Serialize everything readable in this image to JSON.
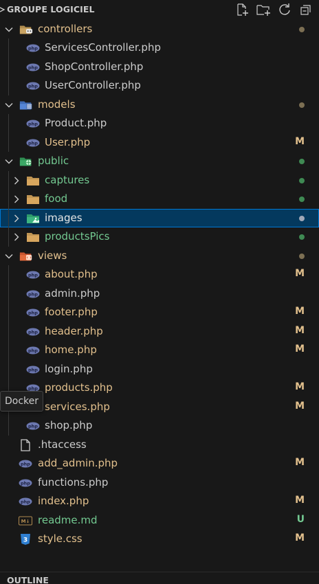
{
  "header": {
    "title": "GROUPE LOGICIEL",
    "actions": [
      "new-file-icon",
      "new-folder-icon",
      "refresh-icon",
      "collapse-all-icon"
    ]
  },
  "colors": {
    "modified": "#e2c08d",
    "untracked": "#73c991",
    "folder_dot": "#8a7a5a",
    "green_dot": "#3f8a53",
    "selected_bg": "#04395e"
  },
  "tree": {
    "items": [
      {
        "label": "controllers",
        "icon": "folder-controllers-icon",
        "depth": 0,
        "expanded": true,
        "color": "#e2c08d",
        "dot": "folder"
      },
      {
        "label": "ServicesController.php",
        "icon": "php-icon",
        "depth": 1,
        "color": "#cccccc"
      },
      {
        "label": "ShopController.php",
        "icon": "php-icon",
        "depth": 1,
        "color": "#cccccc"
      },
      {
        "label": "UserController.php",
        "icon": "php-icon",
        "depth": 1,
        "color": "#cccccc"
      },
      {
        "label": "models",
        "icon": "folder-models-icon",
        "depth": 0,
        "expanded": true,
        "color": "#e2c08d",
        "dot": "folder"
      },
      {
        "label": "Product.php",
        "icon": "php-icon",
        "depth": 1,
        "color": "#cccccc"
      },
      {
        "label": "User.php",
        "icon": "php-icon",
        "depth": 1,
        "color": "#e2c08d",
        "badge": "M"
      },
      {
        "label": "public",
        "icon": "folder-public-icon",
        "depth": 0,
        "expanded": true,
        "color": "#73c991",
        "dot": "green"
      },
      {
        "label": "captures",
        "icon": "folder-icon",
        "depth": 1,
        "expanded": false,
        "color": "#73c991",
        "dot": "green"
      },
      {
        "label": "food",
        "icon": "folder-icon",
        "depth": 1,
        "expanded": false,
        "color": "#73c991",
        "dot": "green"
      },
      {
        "label": "images",
        "icon": "folder-images-icon",
        "depth": 1,
        "expanded": false,
        "color": "#e6e6e6",
        "dot": "grey",
        "selected": true
      },
      {
        "label": "productsPics",
        "icon": "folder-icon",
        "depth": 1,
        "expanded": false,
        "color": "#73c991",
        "dot": "green"
      },
      {
        "label": "views",
        "icon": "folder-views-icon",
        "depth": 0,
        "expanded": true,
        "color": "#e2c08d",
        "dot": "folder"
      },
      {
        "label": "about.php",
        "icon": "php-icon",
        "depth": 1,
        "color": "#e2c08d",
        "badge": "M"
      },
      {
        "label": "admin.php",
        "icon": "php-icon",
        "depth": 1,
        "color": "#cccccc"
      },
      {
        "label": "footer.php",
        "icon": "php-icon",
        "depth": 1,
        "color": "#e2c08d",
        "badge": "M"
      },
      {
        "label": "header.php",
        "icon": "php-icon",
        "depth": 1,
        "color": "#e2c08d",
        "badge": "M"
      },
      {
        "label": "home.php",
        "icon": "php-icon",
        "depth": 1,
        "color": "#e2c08d",
        "badge": "M"
      },
      {
        "label": "login.php",
        "icon": "php-icon",
        "depth": 1,
        "color": "#cccccc"
      },
      {
        "label": "products.php",
        "icon": "php-icon",
        "depth": 1,
        "color": "#e2c08d",
        "badge": "M"
      },
      {
        "label": "services.php",
        "icon": "php-icon",
        "depth": 1,
        "color": "#e2c08d",
        "badge": "M"
      },
      {
        "label": "shop.php",
        "icon": "php-icon",
        "depth": 1,
        "color": "#cccccc"
      },
      {
        "label": ".htaccess",
        "icon": "file-icon",
        "depth": 0,
        "color": "#cccccc",
        "leaf_root": true
      },
      {
        "label": "add_admin.php",
        "icon": "php-icon",
        "depth": 0,
        "color": "#e2c08d",
        "badge": "M",
        "leaf_root": true
      },
      {
        "label": "functions.php",
        "icon": "php-icon",
        "depth": 0,
        "color": "#cccccc",
        "leaf_root": true
      },
      {
        "label": "index.php",
        "icon": "php-icon",
        "depth": 0,
        "color": "#e2c08d",
        "badge": "M",
        "leaf_root": true
      },
      {
        "label": "readme.md",
        "icon": "markdown-icon",
        "depth": 0,
        "color": "#73c991",
        "badge": "U",
        "leaf_root": true
      },
      {
        "label": "style.css",
        "icon": "css-icon",
        "depth": 0,
        "color": "#e2c08d",
        "badge": "M",
        "leaf_root": true
      }
    ]
  },
  "tooltip": {
    "text": "Docker"
  },
  "outline": {
    "title": "OUTLINE"
  }
}
